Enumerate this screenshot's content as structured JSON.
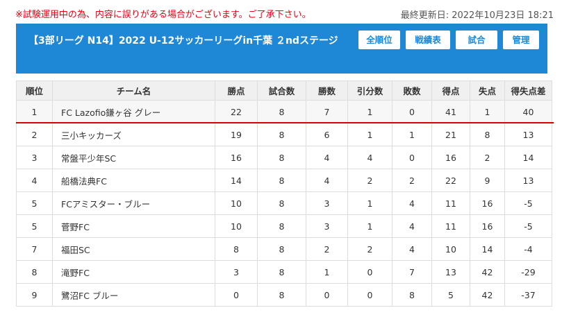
{
  "notice": "※試験運用中の為、内容に誤りがある場合がございます。ご了承下さい。",
  "last_updated": "最終更新日: 2022年10月23日 18:21",
  "league_title": "【3部リーグ N14】2022 U-12サッカーリーグin千葉 ２ndステージ",
  "buttons": {
    "standings": "全順位",
    "results": "戦績表",
    "matches": "試合",
    "manage": "管理"
  },
  "colors": {
    "accent": "#1e88d7",
    "notice": "#e60012",
    "divider": "#d40000"
  },
  "table": {
    "headers": [
      "順位",
      "チーム名",
      "勝点",
      "試合数",
      "勝数",
      "引分数",
      "敗数",
      "得点",
      "失点",
      "得失点差"
    ],
    "rows": [
      [
        "1",
        "FC Lazofio鎌ヶ谷 グレー",
        "22",
        "8",
        "7",
        "1",
        "0",
        "41",
        "1",
        "40"
      ],
      [
        "2",
        "三小キッカーズ",
        "19",
        "8",
        "6",
        "1",
        "1",
        "21",
        "8",
        "13"
      ],
      [
        "3",
        "常盤平少年SC",
        "16",
        "8",
        "4",
        "4",
        "0",
        "16",
        "2",
        "14"
      ],
      [
        "4",
        "船橋法典FC",
        "14",
        "8",
        "4",
        "2",
        "2",
        "22",
        "9",
        "13"
      ],
      [
        "5",
        "FCアミスター・ブルー",
        "10",
        "8",
        "3",
        "1",
        "4",
        "11",
        "16",
        "-5"
      ],
      [
        "5",
        "菅野FC",
        "10",
        "8",
        "3",
        "1",
        "4",
        "11",
        "16",
        "-5"
      ],
      [
        "7",
        "福田SC",
        "8",
        "8",
        "2",
        "2",
        "4",
        "10",
        "14",
        "-4"
      ],
      [
        "8",
        "滝野FC",
        "3",
        "8",
        "1",
        "0",
        "7",
        "13",
        "42",
        "-29"
      ],
      [
        "9",
        "鷺沼FC ブルー",
        "0",
        "8",
        "0",
        "0",
        "8",
        "5",
        "42",
        "-37"
      ]
    ]
  }
}
